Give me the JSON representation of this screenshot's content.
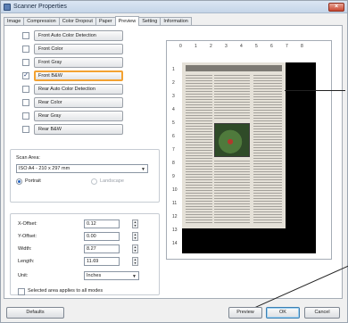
{
  "window": {
    "title": "Scanner Properties",
    "close_glyph": "×"
  },
  "tabs": [
    {
      "label": "Image",
      "active": false
    },
    {
      "label": "Compression",
      "active": false
    },
    {
      "label": "Color Dropout",
      "active": false
    },
    {
      "label": "Paper",
      "active": false
    },
    {
      "label": "Preview",
      "active": true
    },
    {
      "label": "Setting",
      "active": false
    },
    {
      "label": "Information",
      "active": false
    }
  ],
  "modes": [
    {
      "label": "Front Auto Color Detection",
      "checked": false
    },
    {
      "label": "Front Color",
      "checked": false
    },
    {
      "label": "Front Gray",
      "checked": false
    },
    {
      "label": "Front B&W",
      "checked": true,
      "highlighted": true
    },
    {
      "label": "Rear Auto Color Detection",
      "checked": false
    },
    {
      "label": "Rear Color",
      "checked": false
    },
    {
      "label": "Rear Gray",
      "checked": false
    },
    {
      "label": "Rear B&W",
      "checked": false
    }
  ],
  "scan_area": {
    "label": "Scan Area:",
    "selected": "ISO A4 - 210 x 297 mm",
    "portrait_label": "Portrait",
    "landscape_label": "Landscape",
    "orientation": "portrait"
  },
  "offsets": {
    "x_offset": {
      "label": "X-Offset:",
      "value": "0.12"
    },
    "y_offset": {
      "label": "Y-Offset:",
      "value": "0.00"
    },
    "width": {
      "label": "Width:",
      "value": "8.27"
    },
    "length": {
      "label": "Length:",
      "value": "11.69"
    },
    "unit": {
      "label": "Unit:",
      "value": "Inches"
    },
    "apply_all_label": "Selected area applies to all modes",
    "apply_all_checked": false
  },
  "ruler": {
    "top": [
      "0",
      "1",
      "2",
      "3",
      "4",
      "5",
      "6",
      "7",
      "8"
    ],
    "left": [
      "1",
      "2",
      "3",
      "4",
      "5",
      "6",
      "7",
      "8",
      "9",
      "10",
      "11",
      "12",
      "13",
      "14"
    ]
  },
  "buttons": {
    "defaults": "Defaults",
    "preview": "Preview",
    "ok": "OK",
    "cancel": "Cancel"
  },
  "colors": {
    "highlight": "#f3a232",
    "scan_background": "#000000"
  }
}
